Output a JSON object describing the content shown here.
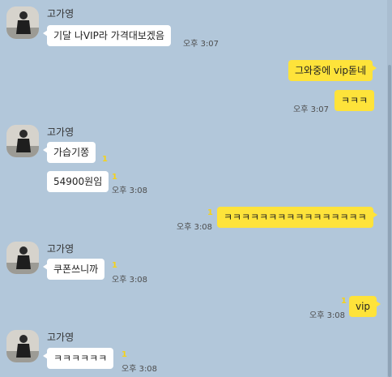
{
  "contact_name": "고가영",
  "messages": [
    {
      "text": "기달 나VIP라 가격대보겠음",
      "time": "오후 3:07"
    },
    {
      "text": "그와중에 vip돋네"
    },
    {
      "text": "ㅋㅋㅋ",
      "time": "오후 3:07"
    },
    {
      "text": "가습기쫑",
      "unread": "1"
    },
    {
      "text": "54900원임",
      "unread": "1",
      "time": "오후 3:08"
    },
    {
      "text": "ㅋㅋㅋㅋㅋㅋㅋㅋㅋㅋㅋㅋㅋㅋㅋㅋ",
      "unread": "1",
      "time": "오후 3:08"
    },
    {
      "text": "쿠폰쓰니까",
      "unread": "1",
      "time": "오후 3:08"
    },
    {
      "text": "vip",
      "unread": "1",
      "time": "오후 3:08"
    },
    {
      "text": "ㅋㅋㅋㅋㅋㅋ",
      "unread": "1",
      "time": "오후 3:08"
    }
  ],
  "colors": {
    "background": "#b2c7da",
    "incoming_bubble": "#ffffff",
    "outgoing_bubble": "#fee33a",
    "unread_count": "#f4d21b"
  }
}
